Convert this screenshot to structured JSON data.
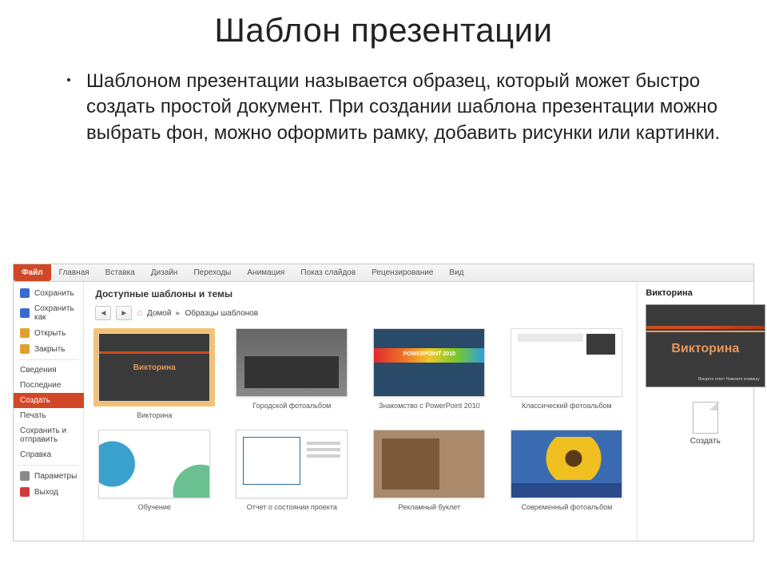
{
  "slide": {
    "title": "Шаблон презентации",
    "body": "Шаблоном презентации называется образец, который может быстро создать простой документ. При создании шаблона презентации можно выбрать фон, можно оформить рамку, добавить рисунки или картинки."
  },
  "ribbon": {
    "file": "Файл",
    "tabs": [
      "Главная",
      "Вставка",
      "Дизайн",
      "Переходы",
      "Анимация",
      "Показ слайдов",
      "Рецензирование",
      "Вид"
    ]
  },
  "sidebar": {
    "items": [
      {
        "label": "Сохранить",
        "icon": "#3a6ad0",
        "type": "cmd"
      },
      {
        "label": "Сохранить как",
        "icon": "#3a6ad0",
        "type": "cmd"
      },
      {
        "label": "Открыть",
        "icon": "#e0a030",
        "type": "cmd"
      },
      {
        "label": "Закрыть",
        "icon": "#e0a030",
        "type": "cmd"
      },
      {
        "label": "Сведения",
        "icon": "",
        "type": "tab"
      },
      {
        "label": "Последние",
        "icon": "",
        "type": "tab"
      },
      {
        "label": "Создать",
        "icon": "",
        "type": "tab",
        "selected": true
      },
      {
        "label": "Печать",
        "icon": "",
        "type": "tab"
      },
      {
        "label": "Сохранить и отправить",
        "icon": "",
        "type": "tab"
      },
      {
        "label": "Справка",
        "icon": "",
        "type": "tab"
      },
      {
        "label": "Параметры",
        "icon": "#8a8a8a",
        "type": "cmd"
      },
      {
        "label": "Выход",
        "icon": "#d03a3a",
        "type": "cmd"
      }
    ]
  },
  "center": {
    "section_title": "Доступные шаблоны и темы",
    "nav": {
      "home_label": "Домой",
      "crumb": "Образцы шаблонов"
    },
    "templates": [
      {
        "label": "Викторина",
        "thumb_text": "Викторина",
        "selected": true
      },
      {
        "label": "Городской фотоальбом",
        "thumb_text": ""
      },
      {
        "label": "Знакомство с PowerPoint 2010",
        "thumb_text": "POWERPOINT 2010"
      },
      {
        "label": "Классический фотоальбом",
        "thumb_text": ""
      },
      {
        "label": "Обучение",
        "thumb_text": ""
      },
      {
        "label": "Отчет о состоянии проекта",
        "thumb_text": ""
      },
      {
        "label": "Рекламный буклет",
        "thumb_text": ""
      },
      {
        "label": "Современный фотоальбом",
        "thumb_text": ""
      }
    ]
  },
  "right": {
    "title": "Викторина",
    "preview_title": "Викторина",
    "preview_corner": "Введите ответ\nНажмите клавишу",
    "create_label": "Создать"
  }
}
